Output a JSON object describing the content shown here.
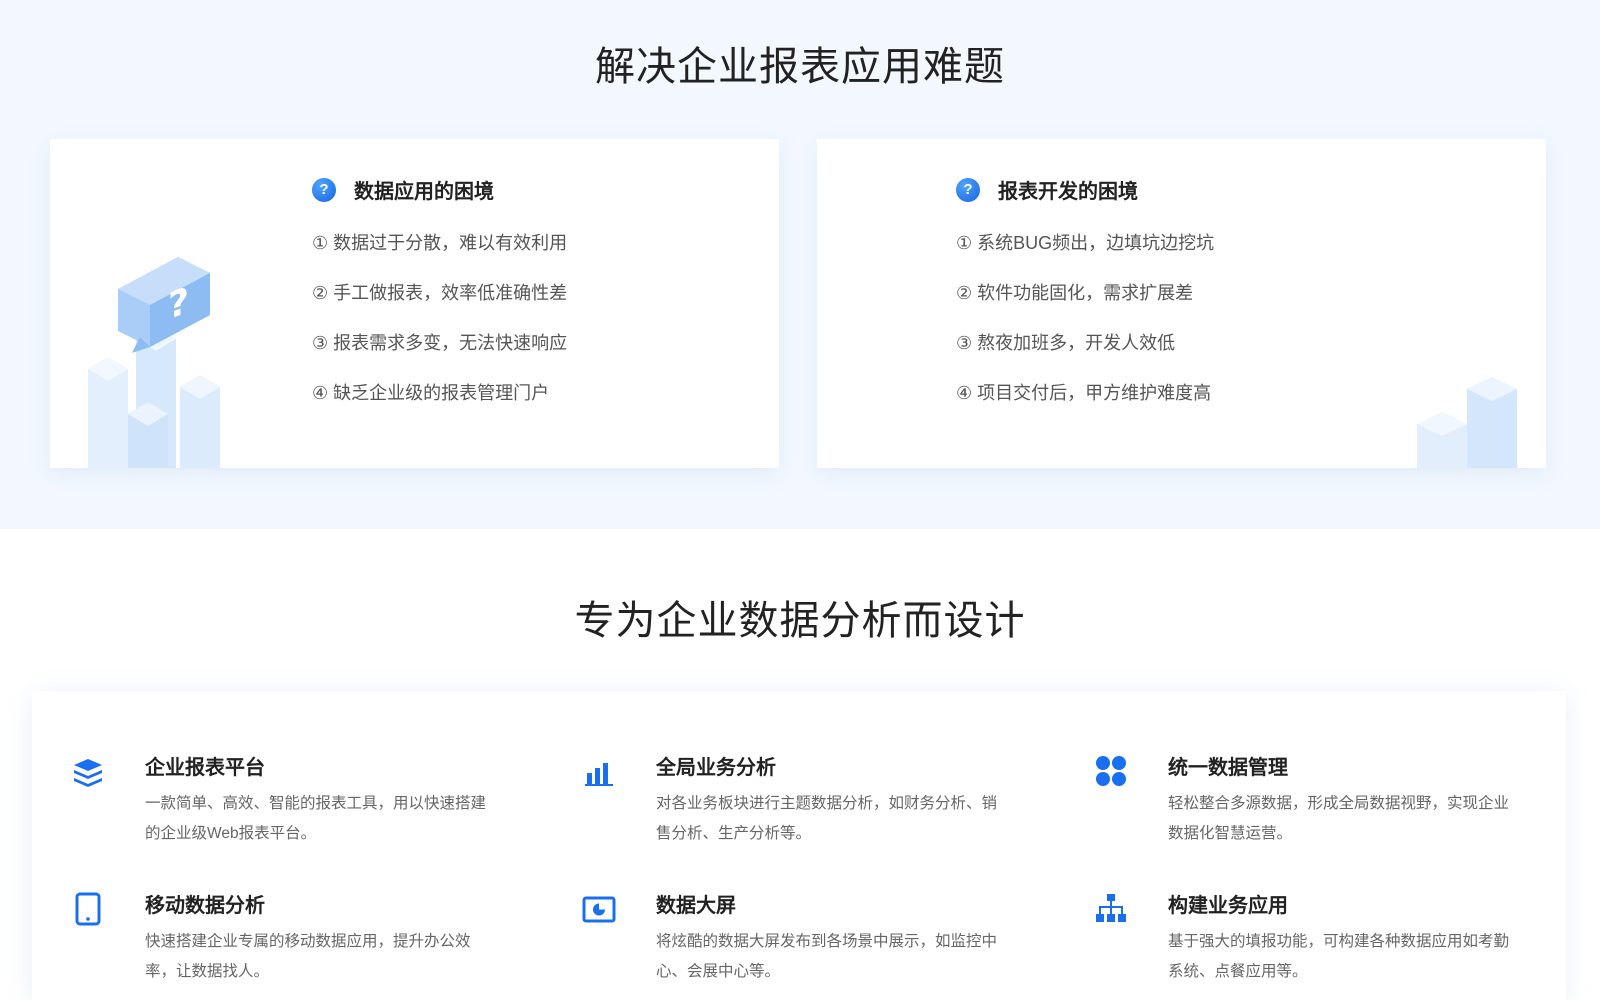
{
  "section1": {
    "title": "解决企业报表应用难题",
    "cards": [
      {
        "title": "数据应用的困境",
        "icon": "question-icon",
        "items": [
          "① 数据过于分散，难以有效利用",
          "② 手工做报表，效率低准确性差",
          "③ 报表需求多变，无法快速响应",
          "④ 缺乏企业级的报表管理门户"
        ]
      },
      {
        "title": "报表开发的困境",
        "icon": "question-icon",
        "items": [
          "① 系统BUG频出，边填坑边挖坑",
          "② 软件功能固化，需求扩展差",
          "③ 熬夜加班多，开发人效低",
          "④ 项目交付后，甲方维护难度高"
        ]
      }
    ]
  },
  "section2": {
    "title": "专为企业数据分析而设计",
    "features": [
      {
        "title": "企业报表平台",
        "desc": "一款简单、高效、智能的报表工具，用以快速搭建的企业级Web报表平台。",
        "icon": "layers-icon"
      },
      {
        "title": "全局业务分析",
        "desc": "对各业务板块进行主题数据分析，如财务分析、销售分析、生产分析等。",
        "icon": "bar-chart-icon"
      },
      {
        "title": "统一数据管理",
        "desc": "轻松整合多源数据，形成全局数据视野，实现企业数据化智慧运营。",
        "icon": "grid-icon"
      },
      {
        "title": "移动数据分析",
        "desc": "快速搭建企业专属的移动数据应用，提升办公效率，让数据找人。",
        "icon": "tablet-icon"
      },
      {
        "title": "数据大屏",
        "desc": "将炫酷的数据大屏发布到各场景中展示，如监控中心、会展中心等。",
        "icon": "screen-pie-icon"
      },
      {
        "title": "构建业务应用",
        "desc": "基于强大的填报功能，可构建各种数据应用如考勤系统、点餐应用等。",
        "icon": "org-chart-icon"
      }
    ]
  },
  "colors": {
    "accent": "#1a6ff0",
    "section_bg": "#f3f8fe",
    "illustration": "#cfe3fb"
  }
}
